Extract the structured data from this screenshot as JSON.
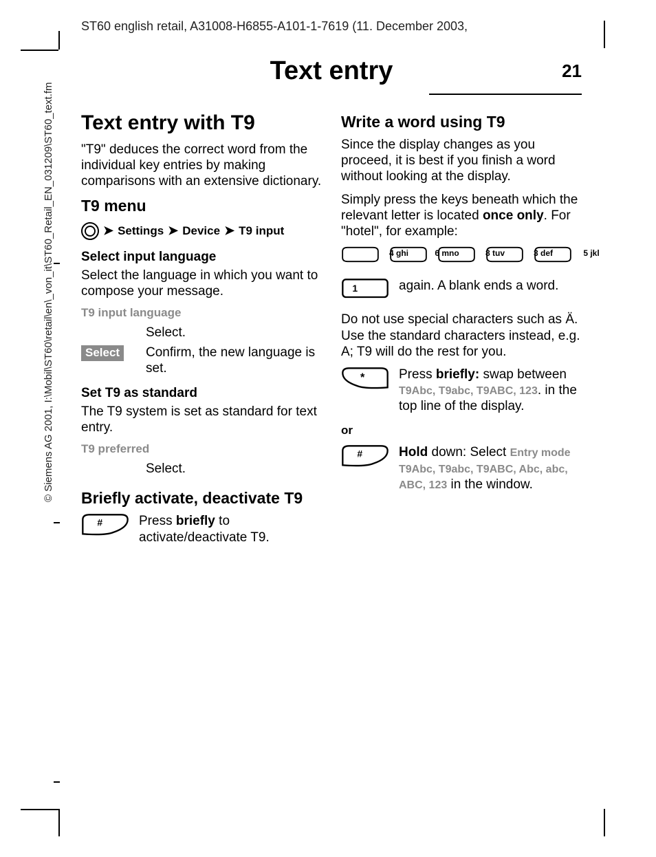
{
  "doc_header": "ST60 english retail, A31008-H6855-A101-1-7619 (11. December 2003,",
  "page_title": "Text entry",
  "page_number": "21",
  "sidebar": "© Siemens AG 2001, I:\\Mobil\\ST60\\retail\\en\\_von_it\\ST60_Retail_EN_031209\\ST60_text.fm",
  "left": {
    "h1": "Text entry with T9",
    "intro": "\"T9\" deduces the correct word from the individual key entries by making comparisons with an extensive dictionary.",
    "t9menu_h2": "T9 menu",
    "menu": {
      "settings": "Settings",
      "device": "Device",
      "t9input": "T9 input"
    },
    "select_lang_h3": "Select input language",
    "select_lang_p": "Select the language in which you want to compose your message.",
    "t9_input_lang": "T9 input language",
    "select_text": "Select.",
    "softkey_select": "Select",
    "confirm_text": "Confirm, the new language is set.",
    "set_standard_h3": "Set T9 as standard",
    "set_standard_p": "The T9 system is set as standard for text entry.",
    "t9_preferred": "T9 preferred",
    "briefly_h2": "Briefly activate, deactivate T9",
    "briefly_p_pre": "Press ",
    "briefly_bold": "briefly",
    "briefly_p_post": " to activate/deactivate T9."
  },
  "right": {
    "h2": "Write a word using T9",
    "p1": "Since the display changes as you proceed, it is best if you finish a word without looking at the display.",
    "p2_pre": "Simply press the keys beneath which the relevant letter is located ",
    "p2_bold": "once only",
    "p2_post": ". For \"hotel\", for example:",
    "keys": [
      "4 ghi",
      "6 mno",
      "8 tuv",
      "3 def",
      "5 jkl"
    ],
    "onekey_text": "again. A blank ends a word.",
    "p3": "Do not use special characters such as Ä. Use the standard characters instead, e.g. A; T9 will do the rest for you.",
    "star_pre": "Press ",
    "star_bold": "briefly:",
    "star_post1": " swap between ",
    "modes_short": "T9Abc, T9abc, T9ABC, 123",
    "star_post2": ". in the top line of the display.",
    "or_label": "or",
    "hold_bold": "Hold",
    "hold_post1": " down: Select ",
    "entry_mode": "Entry mode T9Abc, T9abc, T9ABC, Abc, abc, ABC, 123",
    "hold_post2": " in the window."
  },
  "icons": {
    "hash": "#",
    "star": "*",
    "one": "1"
  }
}
